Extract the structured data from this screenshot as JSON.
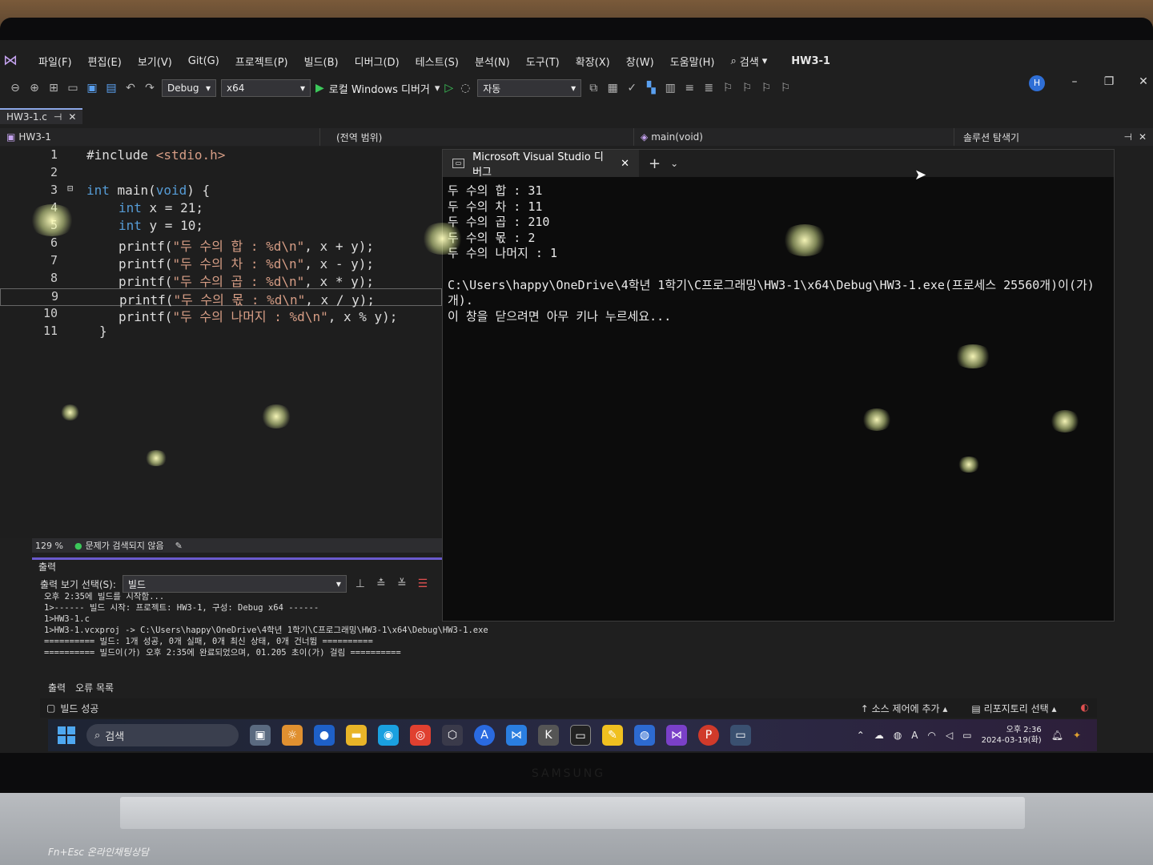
{
  "menu": {
    "items": [
      "파일(F)",
      "편집(E)",
      "보기(V)",
      "Git(G)",
      "프로젝트(P)",
      "빌드(B)",
      "디버그(D)",
      "테스트(S)",
      "분석(N)",
      "도구(T)",
      "확장(X)",
      "창(W)",
      "도움말(H)"
    ],
    "search_label": "검색",
    "project_title": "HW3-1",
    "avatar_letter": "H"
  },
  "toolbar": {
    "config": "Debug",
    "platform": "x64",
    "run_label": "로컬 Windows 디버거",
    "auto_label": "자동"
  },
  "editor": {
    "tab_label": "HW3-1.c",
    "nav_project": "HW3-1",
    "nav_scope": "(전역 범위)",
    "nav_function": "main(void)",
    "zoom": "129 %",
    "issues": "문제가 검색되지 않음",
    "lines": [
      "1",
      "2",
      "3",
      "4",
      "5",
      "6",
      "7",
      "8",
      "9",
      "10",
      "11"
    ],
    "code": {
      "l1_directive": "#include ",
      "l1_header": "<stdio.h>",
      "l3_kw1": "int",
      "l3_mid": " main(",
      "l3_kw2": "void",
      "l3_end": ") {",
      "l4_kw": "int",
      "l4_rest": " x = 21;",
      "l5_kw": "int",
      "l5_rest": " y = 10;",
      "l6_fn": "printf(",
      "l6_str": "\"두 수의 합 : %d\\n\"",
      "l6_args": ", x + y);",
      "l7_fn": "printf(",
      "l7_str": "\"두 수의 차 : %d\\n\"",
      "l7_args": ", x - y);",
      "l8_fn": "printf(",
      "l8_str": "\"두 수의 곱 : %d\\n\"",
      "l8_args": ", x * y);",
      "l9_fn": "printf(",
      "l9_str": "\"두 수의 몫 : %d\\n\"",
      "l9_args": ", x / y);",
      "l10_fn": "printf(",
      "l10_str": "\"두 수의 나머지 : %d\\n\"",
      "l10_args": ", x % y);",
      "l11": "}"
    }
  },
  "solution_explorer": {
    "title": "솔루션 탐색기"
  },
  "console": {
    "title": "Microsoft Visual Studio 디버그",
    "lines": [
      "두 수의 합 : 31",
      "두 수의 차 : 11",
      "두 수의 곱 : 210",
      "두 수의 몫 : 2",
      "두 수의 나머지 : 1"
    ],
    "path_line1": "C:\\Users\\happy\\OneDrive\\4학년 1학기\\C프로그래밍\\HW3-1\\x64\\Debug\\HW3-1.exe(프로세스 25560개)이(가)",
    "path_line2": "개).",
    "prompt": "이 창을 닫으려면 아무 키나 누르세요..."
  },
  "output": {
    "title": "출력",
    "source_label": "출력 보기 선택(S):",
    "source_value": "빌드",
    "lines": [
      "오후 2:35에 빌드를 시작함...",
      "1>------ 빌드 시작: 프로젝트: HW3-1, 구성: Debug x64 ------",
      "1>HW3-1.c",
      "1>HW3-1.vcxproj -> C:\\Users\\happy\\OneDrive\\4학년 1학기\\C프로그래밍\\HW3-1\\x64\\Debug\\HW3-1.exe",
      "========== 빌드: 1개 성공, 0개 실패, 0개 최신 상태, 0개 건너뜀 ==========",
      "========== 빌드이(가) 오후 2:35에 완료되었으며, 01.205 초이(가) 걸림 =========="
    ],
    "tab_output": "출력",
    "tab_errors": "오류 목록"
  },
  "statusbar": {
    "build_status": "빌드 성공",
    "source_control": "소스 제어에 추가",
    "repo": "리포지토리 선택"
  },
  "taskbar": {
    "search": "검색",
    "time": "오후 2:36",
    "date": "2024-03-19(화)"
  },
  "laptop": {
    "sticker": "Fn+Esc 온라인채팅상담",
    "brand": "SAMSUNG"
  }
}
